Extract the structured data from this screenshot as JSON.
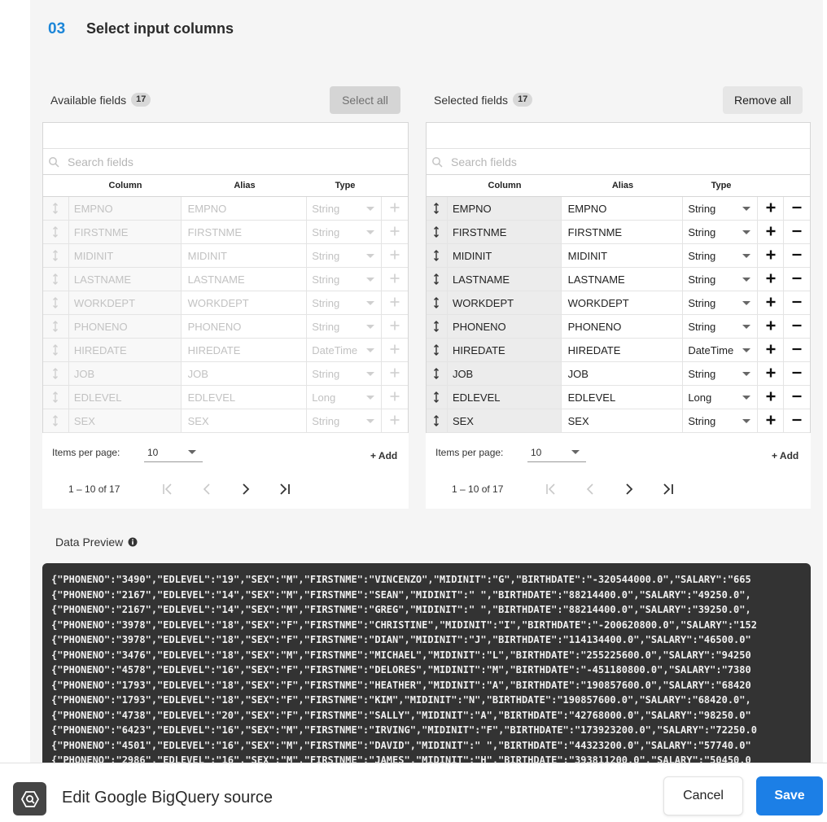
{
  "step": {
    "number": "03",
    "title": "Select input columns"
  },
  "available": {
    "label": "Available fields",
    "count": "17",
    "select_all": "Select all",
    "search_placeholder": "Search fields",
    "headers": {
      "column": "Column",
      "alias": "Alias",
      "type": "Type"
    },
    "rows": [
      {
        "column": "EMPNO",
        "alias": "EMPNO",
        "type": "String"
      },
      {
        "column": "FIRSTNME",
        "alias": "FIRSTNME",
        "type": "String"
      },
      {
        "column": "MIDINIT",
        "alias": "MIDINIT",
        "type": "String"
      },
      {
        "column": "LASTNAME",
        "alias": "LASTNAME",
        "type": "String"
      },
      {
        "column": "WORKDEPT",
        "alias": "WORKDEPT",
        "type": "String"
      },
      {
        "column": "PHONENO",
        "alias": "PHONENO",
        "type": "String"
      },
      {
        "column": "HIREDATE",
        "alias": "HIREDATE",
        "type": "DateTime"
      },
      {
        "column": "JOB",
        "alias": "JOB",
        "type": "String"
      },
      {
        "column": "EDLEVEL",
        "alias": "EDLEVEL",
        "type": "Long"
      },
      {
        "column": "SEX",
        "alias": "SEX",
        "type": "String"
      }
    ],
    "items_per_page_label": "Items per page:",
    "items_per_page": "10",
    "add_label": "+ Add",
    "range": "1 – 10 of 17"
  },
  "selected": {
    "label": "Selected fields",
    "count": "17",
    "remove_all": "Remove all",
    "search_placeholder": "Search fields",
    "headers": {
      "column": "Column",
      "alias": "Alias",
      "type": "Type"
    },
    "rows": [
      {
        "column": "EMPNO",
        "alias": "EMPNO",
        "type": "String"
      },
      {
        "column": "FIRSTNME",
        "alias": "FIRSTNME",
        "type": "String"
      },
      {
        "column": "MIDINIT",
        "alias": "MIDINIT",
        "type": "String"
      },
      {
        "column": "LASTNAME",
        "alias": "LASTNAME",
        "type": "String"
      },
      {
        "column": "WORKDEPT",
        "alias": "WORKDEPT",
        "type": "String"
      },
      {
        "column": "PHONENO",
        "alias": "PHONENO",
        "type": "String"
      },
      {
        "column": "HIREDATE",
        "alias": "HIREDATE",
        "type": "DateTime"
      },
      {
        "column": "JOB",
        "alias": "JOB",
        "type": "String"
      },
      {
        "column": "EDLEVEL",
        "alias": "EDLEVEL",
        "type": "Long"
      },
      {
        "column": "SEX",
        "alias": "SEX",
        "type": "String"
      }
    ],
    "items_per_page_label": "Items per page:",
    "items_per_page": "10",
    "add_label": "+ Add",
    "range": "1 – 10 of 17"
  },
  "preview": {
    "label": "Data Preview",
    "lines": [
      "{\"PHONENO\":\"3490\",\"EDLEVEL\":\"19\",\"SEX\":\"M\",\"FIRSTNME\":\"VINCENZO\",\"MIDINIT\":\"G\",\"BIRTHDATE\":\"-320544000.0\",\"SALARY\":\"665",
      "{\"PHONENO\":\"2167\",\"EDLEVEL\":\"14\",\"SEX\":\"M\",\"FIRSTNME\":\"SEAN\",\"MIDINIT\":\" \",\"BIRTHDATE\":\"88214400.0\",\"SALARY\":\"49250.0\",",
      "{\"PHONENO\":\"2167\",\"EDLEVEL\":\"14\",\"SEX\":\"M\",\"FIRSTNME\":\"GREG\",\"MIDINIT\":\" \",\"BIRTHDATE\":\"88214400.0\",\"SALARY\":\"39250.0\",",
      "{\"PHONENO\":\"3978\",\"EDLEVEL\":\"18\",\"SEX\":\"F\",\"FIRSTNME\":\"CHRISTINE\",\"MIDINIT\":\"I\",\"BIRTHDATE\":\"-200620800.0\",\"SALARY\":\"152",
      "{\"PHONENO\":\"3978\",\"EDLEVEL\":\"18\",\"SEX\":\"F\",\"FIRSTNME\":\"DIAN\",\"MIDINIT\":\"J\",\"BIRTHDATE\":\"114134400.0\",\"SALARY\":\"46500.0\"",
      "{\"PHONENO\":\"3476\",\"EDLEVEL\":\"18\",\"SEX\":\"M\",\"FIRSTNME\":\"MICHAEL\",\"MIDINIT\":\"L\",\"BIRTHDATE\":\"255225600.0\",\"SALARY\":\"94250",
      "{\"PHONENO\":\"4578\",\"EDLEVEL\":\"16\",\"SEX\":\"F\",\"FIRSTNME\":\"DELORES\",\"MIDINIT\":\"M\",\"BIRTHDATE\":\"-451180800.0\",\"SALARY\":\"7380",
      "{\"PHONENO\":\"1793\",\"EDLEVEL\":\"18\",\"SEX\":\"F\",\"FIRSTNME\":\"HEATHER\",\"MIDINIT\":\"A\",\"BIRTHDATE\":\"190857600.0\",\"SALARY\":\"68420",
      "{\"PHONENO\":\"1793\",\"EDLEVEL\":\"18\",\"SEX\":\"F\",\"FIRSTNME\":\"KIM\",\"MIDINIT\":\"N\",\"BIRTHDATE\":\"190857600.0\",\"SALARY\":\"68420.0\",",
      "{\"PHONENO\":\"4738\",\"EDLEVEL\":\"20\",\"SEX\":\"F\",\"FIRSTNME\":\"SALLY\",\"MIDINIT\":\"A\",\"BIRTHDATE\":\"42768000.0\",\"SALARY\":\"98250.0\"",
      "{\"PHONENO\":\"6423\",\"EDLEVEL\":\"16\",\"SEX\":\"M\",\"FIRSTNME\":\"IRVING\",\"MIDINIT\":\"F\",\"BIRTHDATE\":\"173923200.0\",\"SALARY\":\"72250.0",
      "{\"PHONENO\":\"4501\",\"EDLEVEL\":\"16\",\"SEX\":\"M\",\"FIRSTNME\":\"DAVID\",\"MIDINIT\":\" \",\"BIRTHDATE\":\"44323200.0\",\"SALARY\":\"57740.0\"",
      "{\"PHONENO\":\"2986\",\"EDLEVEL\":\"16\",\"SEX\":\"M\",\"FIRSTNME\":\"JAMES\",\"MIDINIT\":\"H\",\"BIRTHDATE\":\"393811200.0\",\"SALARY\":\"50450.0"
    ]
  },
  "bottom_bar": {
    "title": "Edit Google BigQuery source",
    "cancel": "Cancel",
    "save": "Save"
  },
  "colors": {
    "accent": "#1c7fe6",
    "step_number": "#1c86d8",
    "preview_bg": "#333333"
  },
  "icons": {
    "search": "search-icon",
    "drag": "drag-handle-icon",
    "add": "plus-icon",
    "remove": "minus-icon",
    "info": "info-icon",
    "first": "first-page-icon",
    "prev": "prev-page-icon",
    "next": "next-page-icon",
    "last": "last-page-icon",
    "source": "bigquery-icon"
  }
}
